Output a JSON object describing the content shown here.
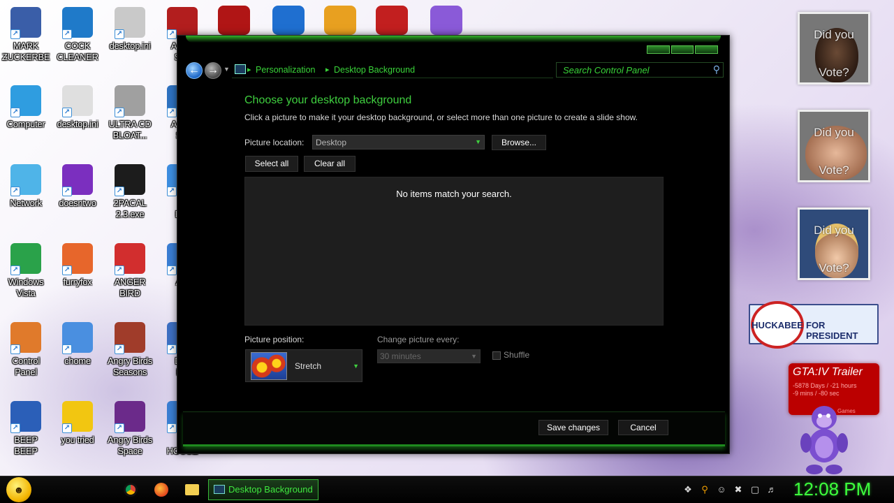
{
  "desktop_icons": [
    {
      "label": "MARK\nZUCKERBE",
      "icon": "mark-zuckerberg-icon"
    },
    {
      "label": "COCK\nCLEANER",
      "icon": "ccleaner-icon"
    },
    {
      "label": "desktop.ini",
      "icon": "settings-file-icon"
    },
    {
      "label": "Angry\nStar",
      "icon": "angry-birds-star-wars-icon"
    },
    {
      "label": "Computer",
      "icon": "computer-icon"
    },
    {
      "label": "desktop.ini",
      "icon": "settings-file-icon"
    },
    {
      "label": "ULTRA CD\nBLOAT...",
      "icon": "cd-icon"
    },
    {
      "label": "Angry\nSta",
      "icon": "angry-birds-icon"
    },
    {
      "label": "Network",
      "icon": "network-icon"
    },
    {
      "label": "doesntwo",
      "icon": "yahoo-messenger-icon"
    },
    {
      "label": "2PACAL\n2.3.exe",
      "icon": "console-icon"
    },
    {
      "label": "PI\nBIR",
      "icon": "app-icon"
    },
    {
      "label": "Windows\nVista",
      "icon": "recycle-bin-icon"
    },
    {
      "label": "furryfox",
      "icon": "firefox-icon"
    },
    {
      "label": "ANGER\nBIRD",
      "icon": "angry-bird-icon"
    },
    {
      "label": "Am",
      "icon": "app-icon"
    },
    {
      "label": "Control\nPanel",
      "icon": "control-panel-icon"
    },
    {
      "label": "chome",
      "icon": "chrome-icon"
    },
    {
      "label": "Angry Birds\nSeasons",
      "icon": "angry-birds-seasons-icon"
    },
    {
      "label": "DIN\nRA",
      "icon": "app-icon"
    },
    {
      "label": "BEEP\nBEEP",
      "icon": "beep-icon"
    },
    {
      "label": "you tried",
      "icon": "star-icon"
    },
    {
      "label": "Angry Birds\nSpace",
      "icon": "angry-birds-space-icon"
    },
    {
      "label": "L\nHOUSE",
      "icon": "app-icon"
    }
  ],
  "top_partial_icons": [
    "star-wars-icon",
    "2-icon",
    "p-icon",
    "dev-cpp-icon",
    "bonzi-icon"
  ],
  "window": {
    "breadcrumb": [
      "Personalization",
      "Desktop Background"
    ],
    "search_placeholder": "Search Control Panel",
    "title": "Choose your desktop background",
    "description": "Click a picture to make it your desktop background, or select more than one picture to create a slide show.",
    "picture_location_label": "Picture location:",
    "picture_location_value": "Desktop",
    "browse_label": "Browse...",
    "select_all_label": "Select all",
    "clear_all_label": "Clear all",
    "empty_message": "No items match your search.",
    "picture_position_label": "Picture position:",
    "picture_position_value": "Stretch",
    "change_picture_label": "Change picture every:",
    "change_picture_value": "30 minutes",
    "shuffle_label": "Shuffle",
    "save_label": "Save changes",
    "cancel_label": "Cancel"
  },
  "gadgets": {
    "vote_cards": [
      {
        "line1": "Did you",
        "line2": "Vote?"
      },
      {
        "line1": "Did you",
        "line2": "Vote?"
      },
      {
        "line1": "Did you",
        "line2": "Vote?"
      }
    ],
    "huckabee": {
      "name": "HUCKABEE",
      "text": "FOR PRESIDENT"
    },
    "gta": {
      "title": "GTA:IV Trailer",
      "countdown": "-5878 Days / -21 hours\n-9 mins / -80 sec",
      "footer": "Games"
    }
  },
  "taskbar": {
    "active_task": "Desktop Background",
    "clock": "12:08 PM"
  }
}
